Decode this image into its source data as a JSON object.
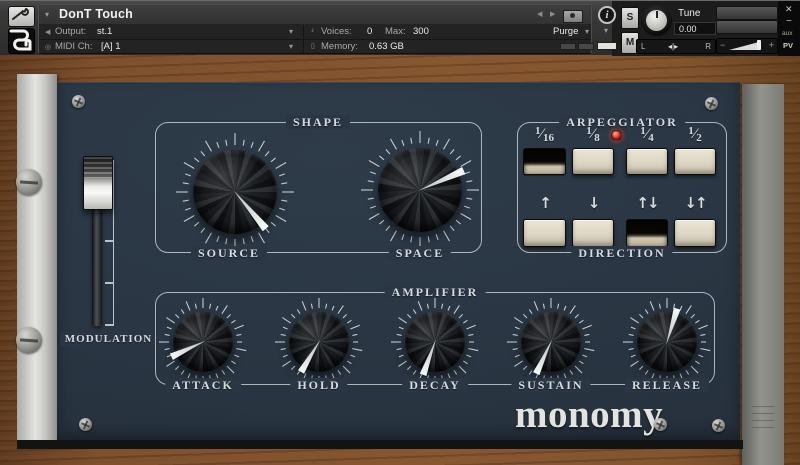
{
  "colors": {
    "panel": "#2a3643",
    "button_cream": "#ddd6c4",
    "led_red": "#e23120",
    "label": "#d6dbe0"
  },
  "header": {
    "title": "DonT Touch",
    "caret_down": "▾",
    "nav_back": "◀",
    "nav_fwd": "▶",
    "speaker_icon": "◀",
    "midi_icon": "◎",
    "voices_icon": "♪",
    "memory_icon": "▯",
    "output_label": "Output:",
    "output_value": "st.1",
    "midi_label": "MIDI Ch:",
    "midi_value": "[A] 1",
    "voices_label": "Voices:",
    "voices_value": "0",
    "max_label": "Max:",
    "max_value": "300",
    "memory_label": "Memory:",
    "memory_value": "0.63 GB",
    "purge_label": "Purge",
    "info_glyph": "i",
    "solo": "S",
    "mute": "M",
    "tune_label": "Tune",
    "tune_value": "0.00",
    "pan_left": "L",
    "pan_center": "◂|▸",
    "pan_right": "R",
    "vol_minus": "−",
    "vol_plus": "+",
    "win_close": "✕",
    "win_min": "−",
    "aux": "aux",
    "pv": "PV"
  },
  "panel": {
    "modulation": {
      "label": "MODULATION"
    },
    "shape": {
      "title": "SHAPE",
      "knobs": [
        {
          "label": "SOURCE",
          "angle": 140
        },
        {
          "label": "SPACE",
          "angle": 66
        }
      ]
    },
    "arpeggiator": {
      "title": "ARPEGGIATOR",
      "direction_label": "DIRECTION",
      "frac_slash": "⁄",
      "led_on": true,
      "rates": [
        {
          "label": "1/16",
          "num": "1",
          "den": "16",
          "pressed": true
        },
        {
          "label": "1/8",
          "num": "1",
          "den": "8",
          "pressed": false
        },
        {
          "label": "1/4",
          "num": "1",
          "den": "4",
          "pressed": false
        },
        {
          "label": "1/2",
          "num": "1",
          "den": "2",
          "pressed": false
        }
      ],
      "directions": [
        {
          "label": "↑",
          "pressed": false
        },
        {
          "label": "↓",
          "pressed": false
        },
        {
          "label": "↑↓",
          "pressed": true
        },
        {
          "label": "↓↑",
          "pressed": false
        }
      ]
    },
    "amplifier": {
      "title": "AMPLIFIER",
      "knobs": [
        {
          "label": "ATTACK",
          "angle": 245
        },
        {
          "label": "HOLD",
          "angle": 211
        },
        {
          "label": "DECAY",
          "angle": 200
        },
        {
          "label": "SUSTAIN",
          "angle": 205
        },
        {
          "label": "RELEASE",
          "angle": 17
        }
      ]
    },
    "logo": "monomy"
  }
}
